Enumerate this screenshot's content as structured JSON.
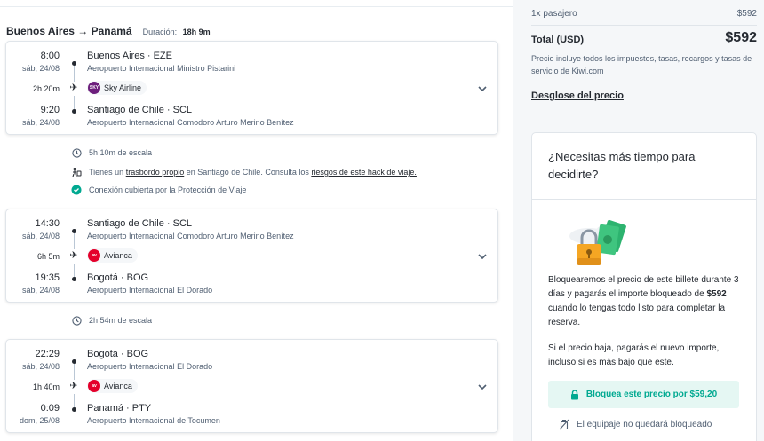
{
  "route": {
    "title": "Buenos Aires → Panamá",
    "duration_label": "Duración:",
    "duration_value": "18h 9m"
  },
  "segments": [
    {
      "dep_time": "8:00",
      "dep_date": "sáb, 24/08",
      "dep_place": "Buenos Aires · EZE",
      "dep_airport": "Aeropuerto Internacional Ministro Pistarini",
      "duration": "2h 20m",
      "airline": "Sky Airline",
      "airline_logo_text": "SKY",
      "airline_color": "#6d1f7c",
      "arr_time": "9:20",
      "arr_date": "sáb, 24/08",
      "arr_place": "Santiago de Chile · SCL",
      "arr_airport": "Aeropuerto Internacional Comodoro Arturo Merino Benítez"
    },
    {
      "dep_time": "14:30",
      "dep_date": "sáb, 24/08",
      "dep_place": "Santiago de Chile · SCL",
      "dep_airport": "Aeropuerto Internacional Comodoro Arturo Merino Benítez",
      "duration": "6h 5m",
      "airline": "Avianca",
      "airline_logo_text": "av",
      "airline_color": "#e4002b",
      "arr_time": "19:35",
      "arr_date": "sáb, 24/08",
      "arr_place": "Bogotá · BOG",
      "arr_airport": "Aeropuerto Internacional El Dorado"
    },
    {
      "dep_time": "22:29",
      "dep_date": "sáb, 24/08",
      "dep_place": "Bogotá · BOG",
      "dep_airport": "Aeropuerto Internacional El Dorado",
      "duration": "1h 40m",
      "airline": "Avianca",
      "airline_logo_text": "av",
      "airline_color": "#e4002b",
      "arr_time": "0:09",
      "arr_date": "dom, 25/08",
      "arr_place": "Panamá · PTY",
      "arr_airport": "Aeropuerto Internacional de Tocumen"
    }
  ],
  "layover1": {
    "stop": "5h 10m de escala",
    "transfer_pre": "Tienes un ",
    "transfer_link": "trasbordo propio",
    "transfer_mid": " en Santiago de Chile. Consulta los ",
    "transfer_link2": "riesgos de este hack de viaje.",
    "protection": "Conexión cubierta por la Protección de Viaje"
  },
  "layover2": {
    "stop": "2h 54m de escala"
  },
  "summary": {
    "pax_label": "1x pasajero",
    "pax_price": "$592",
    "total_label": "Total (USD)",
    "total_value": "$592",
    "total_note": "Precio incluye todos los impuestos, tasas, recargos y tasas de servicio de Kiwi.com",
    "breakdown_link": "Desglose del precio"
  },
  "promo": {
    "title": "¿Necesitas más tiempo para decidirte?",
    "text_pre": "Bloquearemos el precio de este billete durante 3 días y pagarás el importe bloqueado de ",
    "text_amount": "$592",
    "text_post": " cuando lo tengas todo listo para completar la reserva.",
    "text2": "Si el precio baja, pagarás el nuevo importe, incluso si es más bajo que este.",
    "button": "Bloquea este precio por $59,20",
    "luggage_note": "El equipaje no quedará bloqueado"
  },
  "colors": {
    "accent": "#00a991",
    "accent_bg": "#e5f7f3",
    "text": "#252a31",
    "muted": "#4f5e71"
  }
}
